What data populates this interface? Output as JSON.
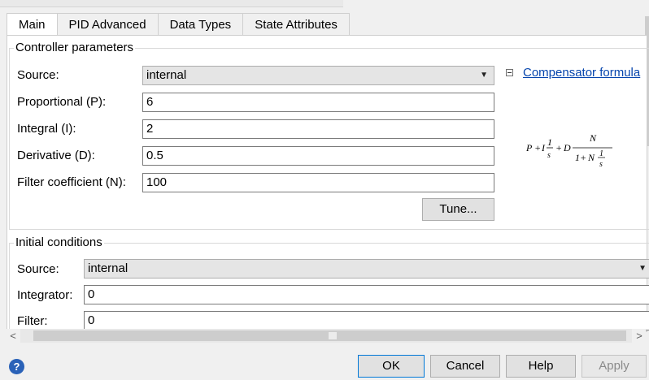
{
  "tabs": [
    {
      "label": "Main"
    },
    {
      "label": "PID Advanced"
    },
    {
      "label": "Data Types"
    },
    {
      "label": "State Attributes"
    }
  ],
  "controller": {
    "title": "Controller parameters",
    "source_label": "Source:",
    "source_value": "internal",
    "link_label": "Compensator formula",
    "proportional_label": "Proportional (P):",
    "proportional_value": "6",
    "integral_label": "Integral (I):",
    "integral_value": "2",
    "derivative_label": "Derivative (D):",
    "derivative_value": "0.5",
    "filter_label": "Filter coefficient (N):",
    "filter_value": "100",
    "tune_label": "Tune..."
  },
  "initial": {
    "title": "Initial conditions",
    "source_label": "Source:",
    "source_value": "internal",
    "integrator_label": "Integrator:",
    "integrator_value": "0",
    "filter_label": "Filter:",
    "filter_value": "0"
  },
  "footer": {
    "help_icon_text": "?",
    "ok_label": "OK",
    "cancel_label": "Cancel",
    "help_label": "Help",
    "apply_label": "Apply"
  },
  "icons": {
    "collapse": "collapse-icon",
    "dropdown": "chevron-down-icon",
    "help": "help-icon"
  }
}
